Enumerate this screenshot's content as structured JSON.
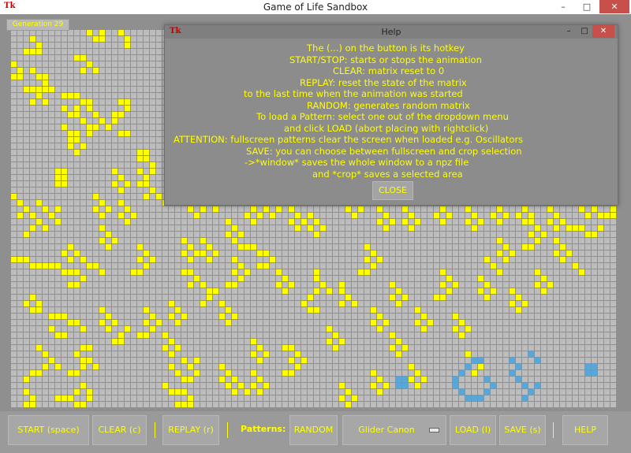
{
  "window": {
    "title": "Game of Life Sandbox",
    "icon_label": "Tk",
    "controls": {
      "minimize": "–",
      "maximize": "□",
      "close": "✕"
    }
  },
  "generation_label": "Generation 29",
  "colors": {
    "cell_alive": "#ffff00",
    "cell_new": "#5aa6d6",
    "cell_dead": "#bdbdbd",
    "grid_line": "#8f8f8f",
    "text": "#ffff00"
  },
  "help_dialog": {
    "title": "Help",
    "icon_label": "Tk",
    "lines": [
      "The (...) on the button is its hotkey",
      "START/STOP: starts or stops the animation",
      "CLEAR: matrix reset to 0",
      "REPLAY: reset the state of the matrix",
      "to the last time when the animation was started",
      "RANDOM: generates random matrix",
      "To load a Pattern: select one out of the dropdown menu",
      "and click LOAD (abort placing with rightclick)",
      "ATTENTION: fullscreen patterns clear the screen when loaded e.g. Oscillators",
      "SAVE: you can choose between fullscreen and crop selection",
      "->*window* saves the whole window to a npz file",
      "and *crop* saves a selected area"
    ],
    "close_label": "CLOSE"
  },
  "toolbar": {
    "start": "START (space)",
    "clear": "CLEAR (c)",
    "replay": "REPLAY (r)",
    "patterns_label": "Patterns:",
    "random": "RANDOM",
    "pattern_selected": "Glider Canon",
    "load": "LOAD (l)",
    "save": "SAVE (s)",
    "help": "HELP"
  }
}
